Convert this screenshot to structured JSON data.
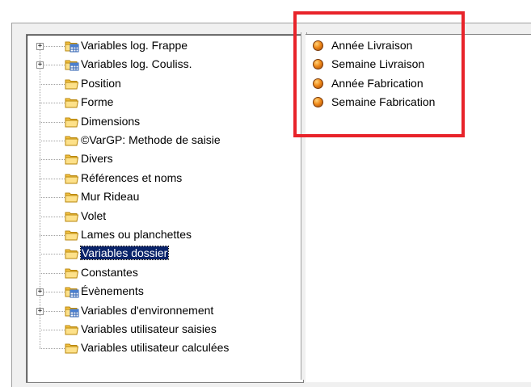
{
  "tree": {
    "items": [
      {
        "label": "Variables log. Frappe",
        "expandable": true,
        "icon": "table-folder-icon"
      },
      {
        "label": "Variables log. Couliss.",
        "expandable": true,
        "icon": "table-folder-icon"
      },
      {
        "label": "Position",
        "expandable": false,
        "icon": "folder-icon"
      },
      {
        "label": "Forme",
        "expandable": false,
        "icon": "folder-icon"
      },
      {
        "label": "Dimensions",
        "expandable": false,
        "icon": "folder-icon"
      },
      {
        "label": "©VarGP: Methode de saisie",
        "expandable": false,
        "icon": "folder-icon"
      },
      {
        "label": "Divers",
        "expandable": false,
        "icon": "folder-icon"
      },
      {
        "label": "Références et noms",
        "expandable": false,
        "icon": "folder-icon"
      },
      {
        "label": "Mur Rideau",
        "expandable": false,
        "icon": "folder-icon"
      },
      {
        "label": "Volet",
        "expandable": false,
        "icon": "folder-icon"
      },
      {
        "label": "Lames ou planchettes",
        "expandable": false,
        "icon": "folder-icon"
      },
      {
        "label": "Variables dossier",
        "expandable": false,
        "icon": "folder-icon",
        "selected": true
      },
      {
        "label": "Constantes",
        "expandable": false,
        "icon": "folder-icon"
      },
      {
        "label": "Évènements",
        "expandable": true,
        "icon": "table-folder-icon"
      },
      {
        "label": "Variables d'environnement",
        "expandable": true,
        "icon": "table-folder-icon"
      },
      {
        "label": "Variables utilisateur saisies",
        "expandable": false,
        "icon": "folder-icon"
      },
      {
        "label": "Variables utilisateur calculées",
        "expandable": false,
        "icon": "folder-icon"
      }
    ]
  },
  "list": {
    "items": [
      {
        "label": "Année Livraison"
      },
      {
        "label": "Semaine Livraison"
      },
      {
        "label": "Année Fabrication"
      },
      {
        "label": "Semaine Fabrication"
      }
    ]
  },
  "colors": {
    "highlight_box": "#e8232a",
    "selection": "#0a246a"
  }
}
